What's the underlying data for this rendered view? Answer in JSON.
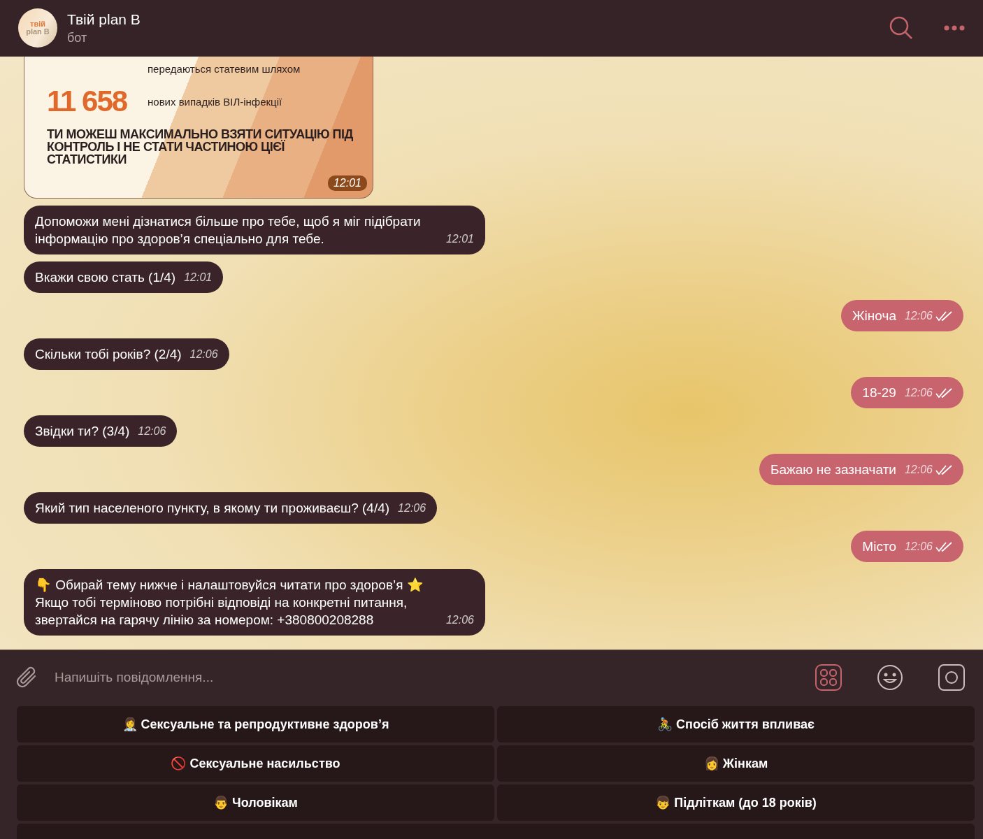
{
  "header": {
    "title": "Твій plan B",
    "subtitle": "бот",
    "avatar_text": [
      "твій",
      "plan B"
    ]
  },
  "stat_card": {
    "stats": [
      {
        "caption": "передаються статевим шляхом"
      },
      {
        "number": "11 658",
        "caption": "нових випадків ВІЛ-інфекції"
      }
    ],
    "statement": "ТИ МОЖЕШ МАКСИМАЛЬНО ВЗЯТИ СИТУАЦІЮ ПІД КОНТРОЛЬ І НЕ СТАТИ ЧАСТИНОЮ ЦІЄЇ СТАТИСТИКИ",
    "time": "12:01"
  },
  "messages": [
    {
      "kind": "incoming",
      "text": "Допоможи мені дізнатися більше про тебе, щоб я міг підібрати інформацію про здоров’я спеціально для тебе.",
      "time": "12:01"
    },
    {
      "kind": "incoming",
      "text": "Вкажи свою стать (1/4)",
      "time": "12:01"
    },
    {
      "kind": "outgoing",
      "text": "Жіноча",
      "time": "12:06",
      "read": true
    },
    {
      "kind": "incoming",
      "text": "Скільки тобі років? (2/4)",
      "time": "12:06"
    },
    {
      "kind": "outgoing",
      "text": "18-29",
      "time": "12:06",
      "read": true
    },
    {
      "kind": "incoming",
      "text": "Звідки ти? (3/4)",
      "time": "12:06"
    },
    {
      "kind": "outgoing",
      "text": "Бажаю не зазначати",
      "time": "12:06",
      "read": true
    },
    {
      "kind": "incoming",
      "text": "Який тип населеного пункту, в якому ти проживаєш? (4/4)",
      "time": "12:06"
    },
    {
      "kind": "outgoing",
      "text": "Місто",
      "time": "12:06",
      "read": true
    },
    {
      "kind": "incoming",
      "text": "👇 Обирай тему нижче і налаштовуйся читати про здоров’я ⭐\nЯкщо тобі терміново потрібні відповіді на конкретні питання, звертайся на гарячу лінію за номером: +380800208288",
      "time": "12:06"
    }
  ],
  "composer": {
    "placeholder": "Напишіть повідомлення..."
  },
  "keyboard": [
    "👩‍⚕️ Сексуальне та репродуктивне здоров’я",
    "🚴 Спосіб життя впливає",
    "🚫 Сексуальне насильство",
    "👩 Жінкам",
    "👨 Чоловікам",
    "👦 Підліткам (до 18 років)"
  ]
}
